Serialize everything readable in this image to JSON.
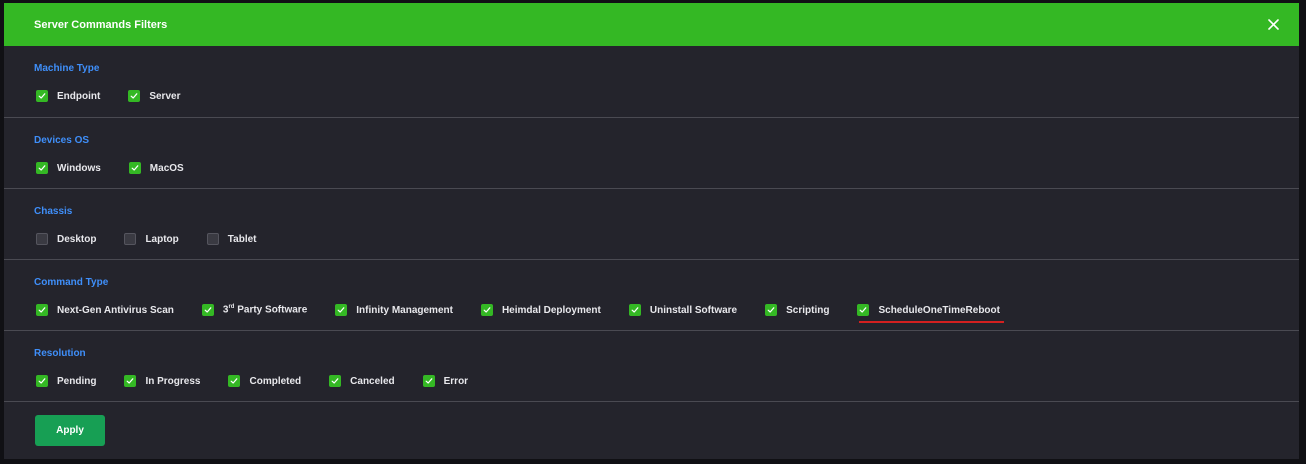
{
  "dialog": {
    "title": "Server Commands Filters",
    "close_icon": "close-icon",
    "header_color": "#34b824",
    "accent_color": "#3f8ffa"
  },
  "sections": [
    {
      "id": "machine-type",
      "title": "Machine Type",
      "options": [
        {
          "label": "Endpoint",
          "checked": true
        },
        {
          "label": "Server",
          "checked": true
        }
      ]
    },
    {
      "id": "devices-os",
      "title": "Devices OS",
      "options": [
        {
          "label": "Windows",
          "checked": true
        },
        {
          "label": "MacOS",
          "checked": true
        }
      ]
    },
    {
      "id": "chassis",
      "title": "Chassis",
      "options": [
        {
          "label": "Desktop",
          "checked": false
        },
        {
          "label": "Laptop",
          "checked": false
        },
        {
          "label": "Tablet",
          "checked": false
        }
      ]
    },
    {
      "id": "command-type",
      "title": "Command Type",
      "options": [
        {
          "label": "Next-Gen Antivirus Scan",
          "checked": true
        },
        {
          "label": "3rd Party Software",
          "checked": true,
          "superscript": "rd",
          "prefix": "3",
          "suffix": " Party Software"
        },
        {
          "label": "Infinity Management",
          "checked": true
        },
        {
          "label": "Heimdal Deployment",
          "checked": true
        },
        {
          "label": "Uninstall Software",
          "checked": true
        },
        {
          "label": "Scripting",
          "checked": true
        },
        {
          "label": "ScheduleOneTimeReboot",
          "checked": true,
          "highlighted": true
        }
      ]
    },
    {
      "id": "resolution",
      "title": "Resolution",
      "options": [
        {
          "label": "Pending",
          "checked": true
        },
        {
          "label": "In Progress",
          "checked": true
        },
        {
          "label": "Completed",
          "checked": true
        },
        {
          "label": "Canceled",
          "checked": true
        },
        {
          "label": "Error",
          "checked": true
        }
      ]
    }
  ],
  "footer": {
    "apply_label": "Apply"
  }
}
